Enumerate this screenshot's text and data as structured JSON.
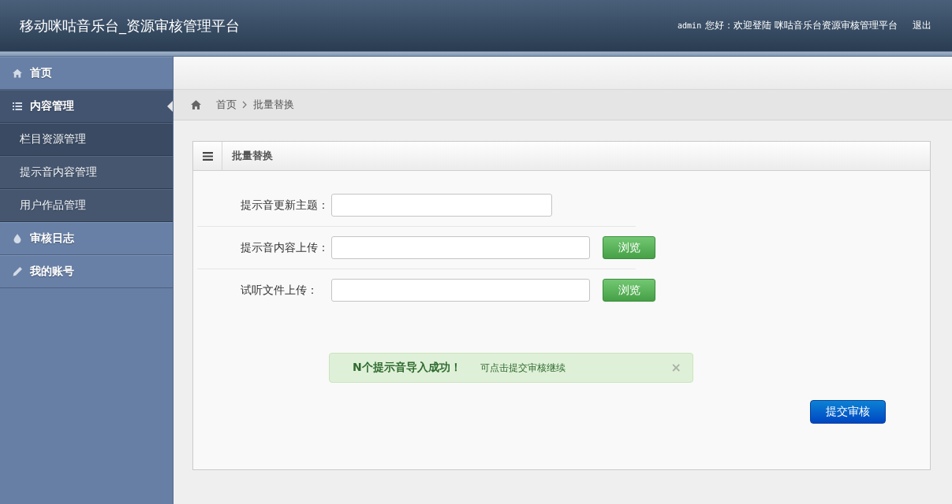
{
  "header": {
    "title": "移动咪咕音乐台_资源审核管理平台",
    "username": "admin",
    "greeting": "您好：欢迎登陆 咪咕音乐台资源审核管理平台",
    "logout": "退出"
  },
  "sidebar": {
    "items": [
      {
        "label": "首页",
        "selected": false
      },
      {
        "label": "内容管理",
        "selected": true,
        "children": [
          {
            "label": "栏目资源管理",
            "selected": true
          },
          {
            "label": "提示音内容管理",
            "selected": false
          },
          {
            "label": "用户作品管理",
            "selected": false
          }
        ]
      },
      {
        "label": "审核日志",
        "selected": false
      },
      {
        "label": "我的账号",
        "selected": false
      }
    ]
  },
  "breadcrumb": [
    {
      "label": "首页"
    },
    {
      "label": "批量替换"
    }
  ],
  "panel": {
    "title": "批量替换",
    "fields": [
      {
        "kind": "text",
        "label": "提示音更新主题："
      },
      {
        "kind": "file",
        "label": "提示音内容上传：",
        "button": "浏览"
      },
      {
        "kind": "file",
        "label": "试听文件上传：",
        "button": "浏览"
      }
    ],
    "alert": {
      "title": "N个提示音导入成功！",
      "message": "可点击提交审核继续",
      "close": "×"
    },
    "submit": "提交审核"
  }
}
